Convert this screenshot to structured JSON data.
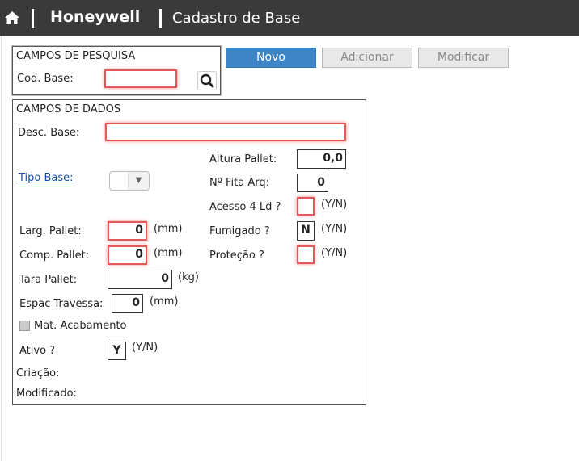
{
  "header": {
    "brand": "Honeywell",
    "title": "Cadastro de Base"
  },
  "toolbar": {
    "novo": "Novo",
    "adicionar": "Adicionar",
    "modificar": "Modificar"
  },
  "search": {
    "section_title": "CAMPOS DE PESQUISA",
    "cod_base_label": "Cod. Base:",
    "cod_base_value": ""
  },
  "data": {
    "section_title": "CAMPOS DE DADOS",
    "desc_base_label": "Desc. Base:",
    "tipo_base_label": "Tipo Base:",
    "larg_pallet_label": "Larg. Pallet:",
    "larg_pallet_value": "0",
    "larg_pallet_unit": "(mm)",
    "comp_pallet_label": "Comp. Pallet:",
    "comp_pallet_value": "0",
    "comp_pallet_unit": "(mm)",
    "tara_pallet_label": "Tara Pallet:",
    "tara_pallet_value": "0",
    "tara_pallet_unit": "(kg)",
    "espac_label": "Espac Travessa:",
    "espac_value": "0",
    "espac_unit": "(mm)",
    "mat_acabamento_label": "Mat. Acabamento",
    "ativo_label": "Ativo ?",
    "ativo_value": "Y",
    "ativo_unit": "(Y/N)",
    "criacao_label": "Criação:",
    "modificado_label": "Modificado:",
    "altura_pallet_label": "Altura Pallet:",
    "altura_pallet_value": "0,0",
    "fita_label": "Nº Fita Arq:",
    "fita_value": "0",
    "acesso_label": "Acesso 4 Ld ?",
    "acesso_unit": "(Y/N)",
    "fumigado_label": "Fumigado ?",
    "fumigado_value": "N",
    "fumigado_unit": "(Y/N)",
    "protecao_label": "Proteção ?",
    "protecao_unit": "(Y/N)"
  }
}
